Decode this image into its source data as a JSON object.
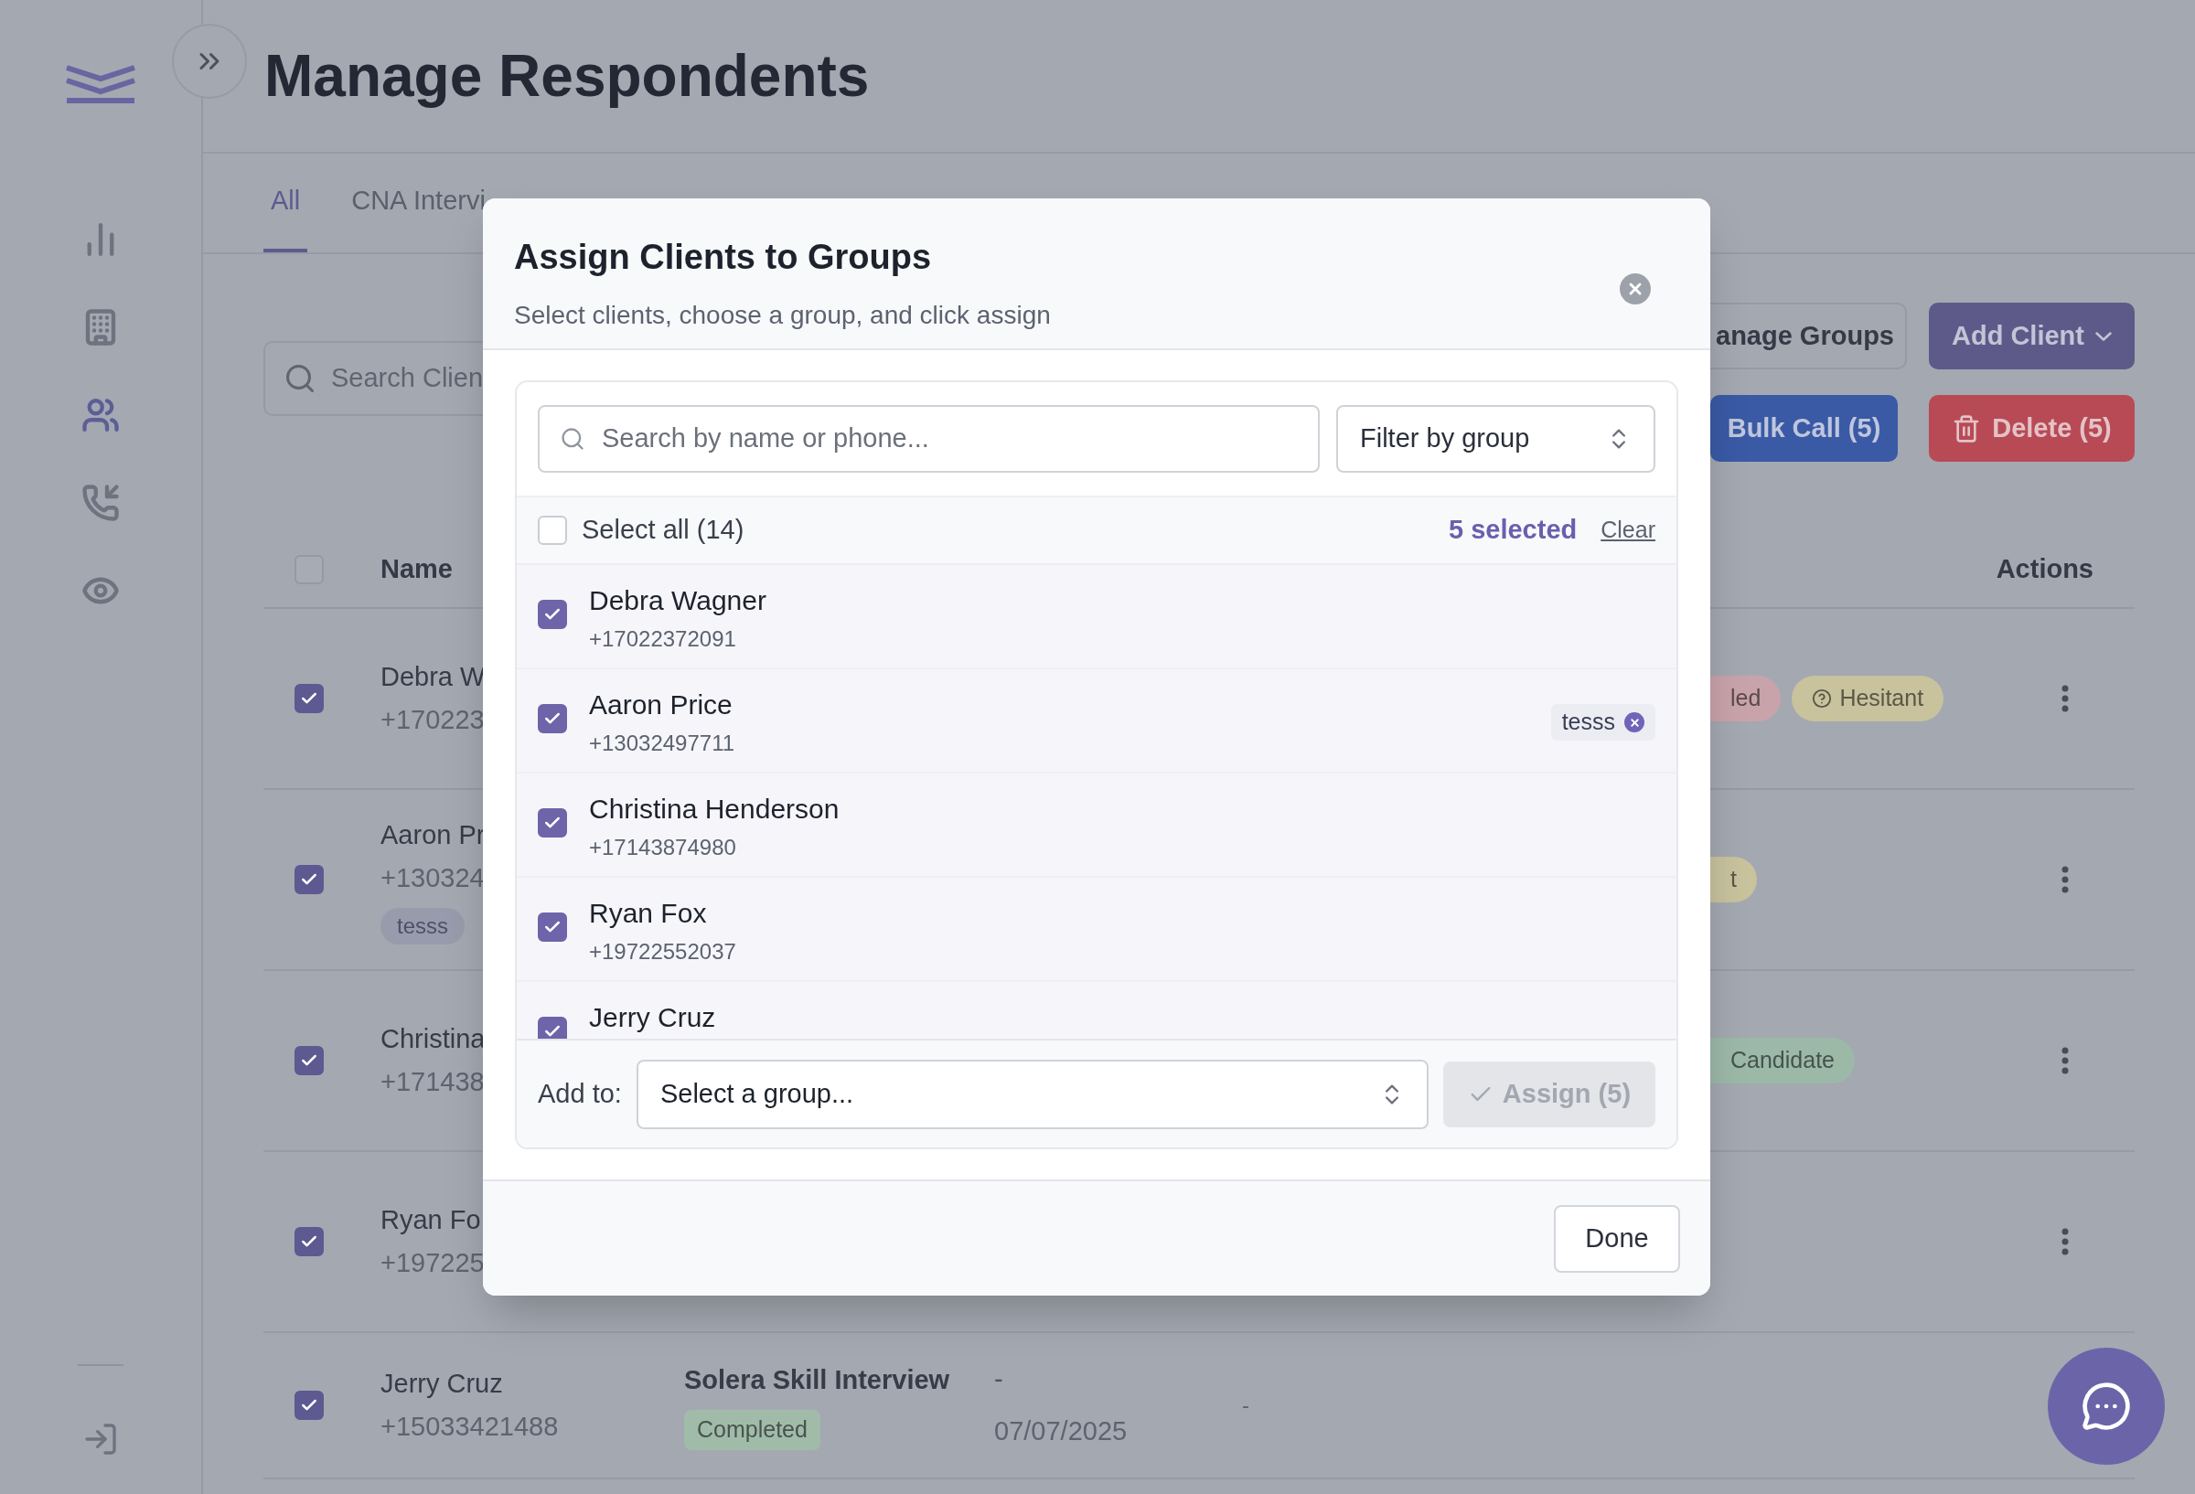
{
  "sidebar": {
    "items": [
      {
        "kind": "chart",
        "selected": false
      },
      {
        "kind": "building",
        "selected": false
      },
      {
        "kind": "people",
        "selected": true
      },
      {
        "kind": "phone",
        "selected": false
      },
      {
        "kind": "eye",
        "selected": false
      }
    ]
  },
  "page": {
    "title": "Manage Respondents"
  },
  "tabs": [
    {
      "label": "All",
      "selected": true
    },
    {
      "label": "CNA Intervi",
      "selected": false
    }
  ],
  "search": {
    "placeholder": "Search Clien"
  },
  "toolbar": {
    "buttons": [
      {
        "label": "anage Groups",
        "kind": "outline"
      },
      {
        "label": "Add Client",
        "kind": "menu"
      },
      {
        "label": "Bulk Call (5)",
        "kind": "call"
      },
      {
        "label": "Delete (5)",
        "kind": "delete"
      }
    ]
  },
  "table": {
    "header_checked": false,
    "columns": [
      {
        "label": "Name"
      },
      {
        "label": "Actions"
      }
    ],
    "rows": [
      {
        "checked": true,
        "more_menu": true,
        "name": "Debra W",
        "phone": "+170223",
        "badges": [
          {
            "label": "led",
            "color": "#c9a3aa",
            "cut": true
          },
          {
            "label": "Hesitant",
            "color": "#c8c29d",
            "cut": false,
            "kind": "help"
          }
        ]
      },
      {
        "checked": true,
        "more_menu": true,
        "name": "Aaron Pr",
        "phone": "+130324",
        "tags": [
          "tesss"
        ],
        "badges": [
          {
            "label": "t",
            "color": "#c8c29d",
            "cut": true
          }
        ]
      },
      {
        "checked": true,
        "more_menu": true,
        "name": "Christina",
        "phone": "+171438",
        "badges": [
          {
            "label": "Candidate",
            "color": "#9cb9a8",
            "cut": true
          }
        ]
      },
      {
        "checked": true,
        "more_menu": true,
        "name": "Ryan Fo",
        "phone": "+197225"
      },
      {
        "checked": true,
        "name": "Jerry Cruz",
        "phone": "+15033421488",
        "interview": "Solera Skill Interview",
        "status": {
          "label": "Completed",
          "color": "#a1bba9"
        },
        "column_3": "-",
        "date": "07/07/2025",
        "column_4": "-"
      }
    ]
  },
  "modal": {
    "title": "Assign Clients to Groups",
    "subtitle": "Select clients, choose a group, and click assign",
    "search": {
      "placeholder": "Search by name or phone..."
    },
    "filter": {
      "value": "Filter by group"
    },
    "select_all": {
      "label": "Select all (14)",
      "checked": false
    },
    "selected_count": "5 selected",
    "clear": "Clear",
    "clients": [
      {
        "name": "Debra Wagner",
        "phone": "+17022372091",
        "checked": true
      },
      {
        "name": "Aaron Price",
        "phone": "+13032497711",
        "checked": true,
        "tags": [
          "tesss"
        ]
      },
      {
        "name": "Christina Henderson",
        "phone": "+17143874980",
        "checked": true
      },
      {
        "name": "Ryan Fox",
        "phone": "+19722552037",
        "checked": true
      },
      {
        "name": "Jerry Cruz",
        "checked": true
      }
    ],
    "add_to": {
      "label": "Add to:",
      "value": "Select a group..."
    },
    "assign": {
      "label": "Assign (5)",
      "disabled": true
    },
    "done": "Done"
  }
}
